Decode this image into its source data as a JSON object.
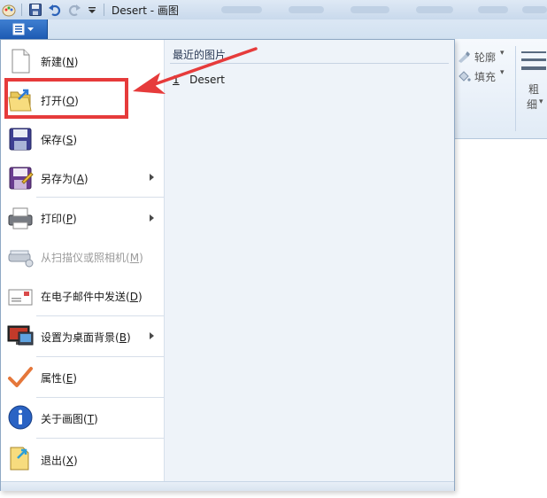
{
  "window": {
    "title": "Desert - 画图",
    "quick_access": [
      "paint-icon",
      "save-icon",
      "undo-icon",
      "redo-icon",
      "customize-dropdown-icon"
    ]
  },
  "ribbon": {
    "outline_label": "轮廓",
    "fill_label": "填充",
    "size_label_1": "粗",
    "size_label_2": "细"
  },
  "app_menu": {
    "items": [
      {
        "icon": "new-file-icon",
        "label": "新建",
        "key": "N",
        "submenu": false,
        "disabled": false
      },
      {
        "icon": "open-folder-icon",
        "label": "打开",
        "key": "O",
        "submenu": false,
        "disabled": false
      },
      {
        "icon": "save-icon",
        "label": "保存",
        "key": "S",
        "submenu": false,
        "disabled": false
      },
      {
        "icon": "save-as-icon",
        "label": "另存为",
        "key": "A",
        "submenu": true,
        "disabled": false
      },
      {
        "icon": "printer-icon",
        "label": "打印",
        "key": "P",
        "submenu": true,
        "disabled": false
      },
      {
        "icon": "scanner-icon",
        "label": "从扫描仪或照相机",
        "key": "M",
        "submenu": false,
        "disabled": true
      },
      {
        "icon": "email-icon",
        "label": "在电子邮件中发送",
        "key": "D",
        "submenu": false,
        "disabled": false
      },
      {
        "icon": "desktop-background-icon",
        "label": "设置为桌面背景",
        "key": "B",
        "submenu": true,
        "disabled": false
      },
      {
        "icon": "checkmark-icon",
        "label": "属性",
        "key": "E",
        "submenu": false,
        "disabled": false
      },
      {
        "icon": "info-icon",
        "label": "关于画图",
        "key": "T",
        "submenu": false,
        "disabled": false
      },
      {
        "icon": "exit-icon",
        "label": "退出",
        "key": "X",
        "submenu": false,
        "disabled": false
      }
    ],
    "recent": {
      "header": "最近的图片",
      "items": [
        {
          "index": "1",
          "name": "Desert"
        }
      ]
    }
  },
  "colors": {
    "highlight": "#e63b3b",
    "menu_accent": "#1d5bb3",
    "recent_pane": "#eef3f9"
  }
}
